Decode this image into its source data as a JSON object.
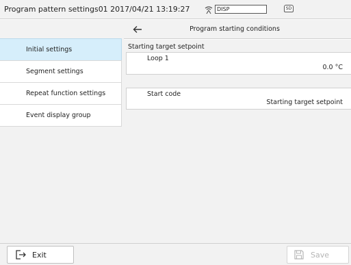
{
  "titlebar": {
    "title": "Program pattern settings01 2017/04/21 13:19:27",
    "disp_label": "DISP",
    "sd_label": "SD"
  },
  "sidebar": {
    "items": [
      {
        "label": "Initial settings",
        "active": true
      },
      {
        "label": "Segment settings",
        "active": false
      },
      {
        "label": "Repeat function settings",
        "active": false
      },
      {
        "label": "Event display group",
        "active": false
      }
    ]
  },
  "header": {
    "title": "Program starting conditions",
    "back_icon": "arrow-left-icon"
  },
  "main": {
    "group_label": "Starting target setpoint",
    "loop": {
      "label": "Loop 1",
      "value": "0.0 °C"
    },
    "start_code": {
      "label": "Start code",
      "value": "Starting target setpoint"
    }
  },
  "footer": {
    "exit_label": "Exit",
    "save_label": "Save"
  },
  "colors": {
    "active_item": "#d6eefb",
    "panel_bg": "#f2f2f2",
    "disabled_text": "#b5b5b5"
  }
}
